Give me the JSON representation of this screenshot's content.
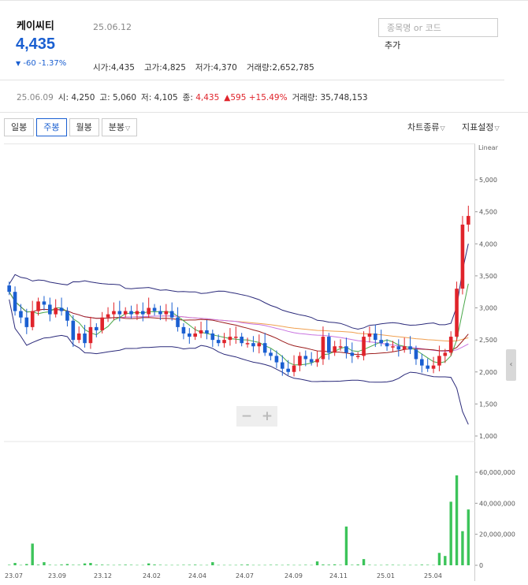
{
  "stock": {
    "name": "케이씨티",
    "price": "4,435",
    "change_arrow": "▼",
    "change": "-60 -1.37%",
    "date": "25.06.12"
  },
  "ohlc": {
    "open_label": "시가",
    "open": "4,435",
    "high_label": "고가",
    "high": "4,825",
    "low_label": "저가",
    "low": "4,370",
    "volume_label": "거래량",
    "volume": "2,652,785"
  },
  "search": {
    "placeholder": "종목명 or 코드",
    "add_label": "추가"
  },
  "summary": {
    "date": "25.06.09",
    "open_label": "시",
    "open": "4,250",
    "high_label": "고",
    "high": "5,060",
    "low_label": "저",
    "low": "4,105",
    "close_label": "종",
    "close": "4,435",
    "change": "▲595 +15.49%",
    "volume_label": "거래량",
    "volume": "35,748,153"
  },
  "tabs": [
    {
      "label": "일봉"
    },
    {
      "label": "주봉",
      "active": true
    },
    {
      "label": "월봉"
    },
    {
      "label": "분봉"
    }
  ],
  "menus": {
    "chart_type": "차트종류",
    "indicator": "지표설정"
  },
  "chart_data": {
    "type": "candlestick",
    "price_scale_label": "Linear",
    "y_ticks": [
      "5,000",
      "4,500",
      "4,000",
      "3,500",
      "3,000",
      "2,500",
      "2,000",
      "1,500",
      "1,000"
    ],
    "ylim": [
      1000,
      5000
    ],
    "volume_ticks": [
      "60,000,000",
      "40,000,000",
      "20,000,000",
      "0"
    ],
    "x_ticks": [
      "23.07",
      "23.09",
      "23.12",
      "24.02",
      "24.04",
      "24.07",
      "24.09",
      "24.11",
      "25.01",
      "25.04"
    ],
    "colors": {
      "up": "#e0242b",
      "down": "#1a5fd1",
      "volume": "#3cc45a",
      "ma_short": "#4aa84a",
      "ma_mid": "#9b1b1b",
      "ma_long": "#c873e0",
      "ma_xlong": "#f0a050",
      "band": "#2b2a7a"
    },
    "close_series": [
      3250,
      2950,
      2850,
      2700,
      2950,
      3100,
      3050,
      2900,
      3000,
      2950,
      2800,
      2500,
      2600,
      2450,
      2700,
      2650,
      2850,
      2900,
      2950,
      2900,
      2950,
      2900,
      2950,
      2900,
      3000,
      2950,
      2900,
      2950,
      2850,
      2700,
      2600,
      2550,
      2600,
      2650,
      2600,
      2500,
      2450,
      2500,
      2550,
      2550,
      2450,
      2450,
      2400,
      2450,
      2300,
      2250,
      2150,
      2050,
      2000,
      2100,
      2250,
      2200,
      2150,
      2200,
      2550,
      2300,
      2400,
      2400,
      2300,
      2250,
      2250,
      2550,
      2600,
      2500,
      2450,
      2400,
      2400,
      2350,
      2400,
      2350,
      2200,
      2100,
      2050,
      2100,
      2250,
      2300,
      2550,
      3300,
      4300,
      4435
    ],
    "volume_series_m": [
      0.3,
      1.5,
      0.2,
      0.8,
      14,
      0.4,
      2,
      0.3,
      0.2,
      0.5,
      0.8,
      0.3,
      0.3,
      1.2,
      1.5,
      0.4,
      0.4,
      0.3,
      0.2,
      0.3,
      0.4,
      0.3,
      0.2,
      0.2,
      1.2,
      0.5,
      0.3,
      0.2,
      0.2,
      0.2,
      0.3,
      0.3,
      0.4,
      0.2,
      0.2,
      2,
      0.2,
      0.2,
      0.2,
      0.2,
      0.4,
      0.5,
      0.2,
      0.2,
      0.2,
      0.3,
      0.3,
      0.2,
      0.3,
      0.2,
      0.2,
      0.3,
      0.2,
      2.5,
      0.5,
      0.4,
      0.6,
      0.3,
      25,
      0.3,
      0.5,
      4,
      0.3,
      0.2,
      0.2,
      0.3,
      0.3,
      0.2,
      0.2,
      0.2,
      0.2,
      0.4,
      0.3,
      0.2,
      8,
      6,
      41,
      58,
      22,
      36
    ]
  },
  "zoom": {
    "minus": "−",
    "plus": "+"
  },
  "side_tab_glyph": "‹"
}
